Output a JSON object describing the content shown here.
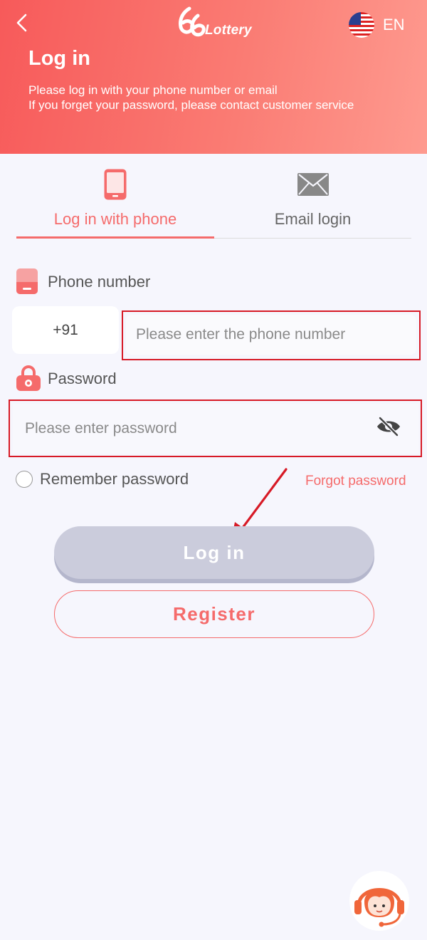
{
  "header": {
    "logo_text": "Lottery",
    "language": "EN",
    "title": "Log in",
    "description_line1": "Please log in with your phone number or email",
    "description_line2": "If you forget your password, please contact customer service"
  },
  "tabs": [
    {
      "label": "Log in with phone",
      "active": true
    },
    {
      "label": "Email login",
      "active": false
    }
  ],
  "phone_field": {
    "label": "Phone number",
    "country_code": "+91",
    "placeholder": "Please enter the phone number",
    "value": ""
  },
  "password_field": {
    "label": "Password",
    "placeholder": "Please enter password",
    "value": ""
  },
  "remember_label": "Remember password",
  "forgot_label": "Forgot password",
  "login_label": "Log in",
  "register_label": "Register",
  "colors": {
    "accent": "#f56b6b",
    "highlight_box": "#d71a26",
    "disabled_button": "#cbccdc",
    "background": "#f6f6fd"
  },
  "icons": [
    "back-arrow-icon",
    "globe-flag-icon",
    "phone-icon",
    "envelope-icon",
    "lock-icon",
    "eye-off-icon",
    "headset-support-icon"
  ]
}
